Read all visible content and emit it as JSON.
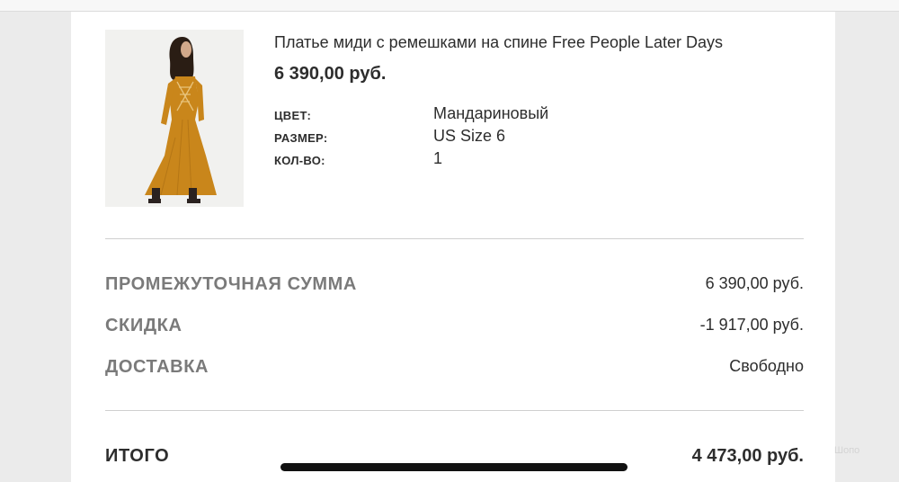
{
  "product": {
    "title": "Платье миди с ремешками на спине Free People Later Days",
    "price": "6 390,00 руб.",
    "image_icon": "dress-photo",
    "attributes": [
      {
        "label": "ЦВЕТ:",
        "value": "Мандариновый"
      },
      {
        "label": "РАЗМЕР:",
        "value": "US Size 6"
      },
      {
        "label": "КОЛ-ВО:",
        "value": "1"
      }
    ]
  },
  "summary": {
    "subtotal": {
      "label": "ПРОМЕЖУТОЧНАЯ СУММА",
      "value": "6 390,00 руб."
    },
    "discount": {
      "label": "СКИДКА",
      "value": "-1 917,00 руб."
    },
    "delivery": {
      "label": "ДОСТАВКА",
      "value": "Свободно"
    },
    "total": {
      "label": "ИТОГО",
      "value": "4 473,00 руб."
    }
  },
  "watermark": "Шопо",
  "colors": {
    "dress": "#c9861b",
    "background": "#ebebeb",
    "card": "#ffffff"
  }
}
